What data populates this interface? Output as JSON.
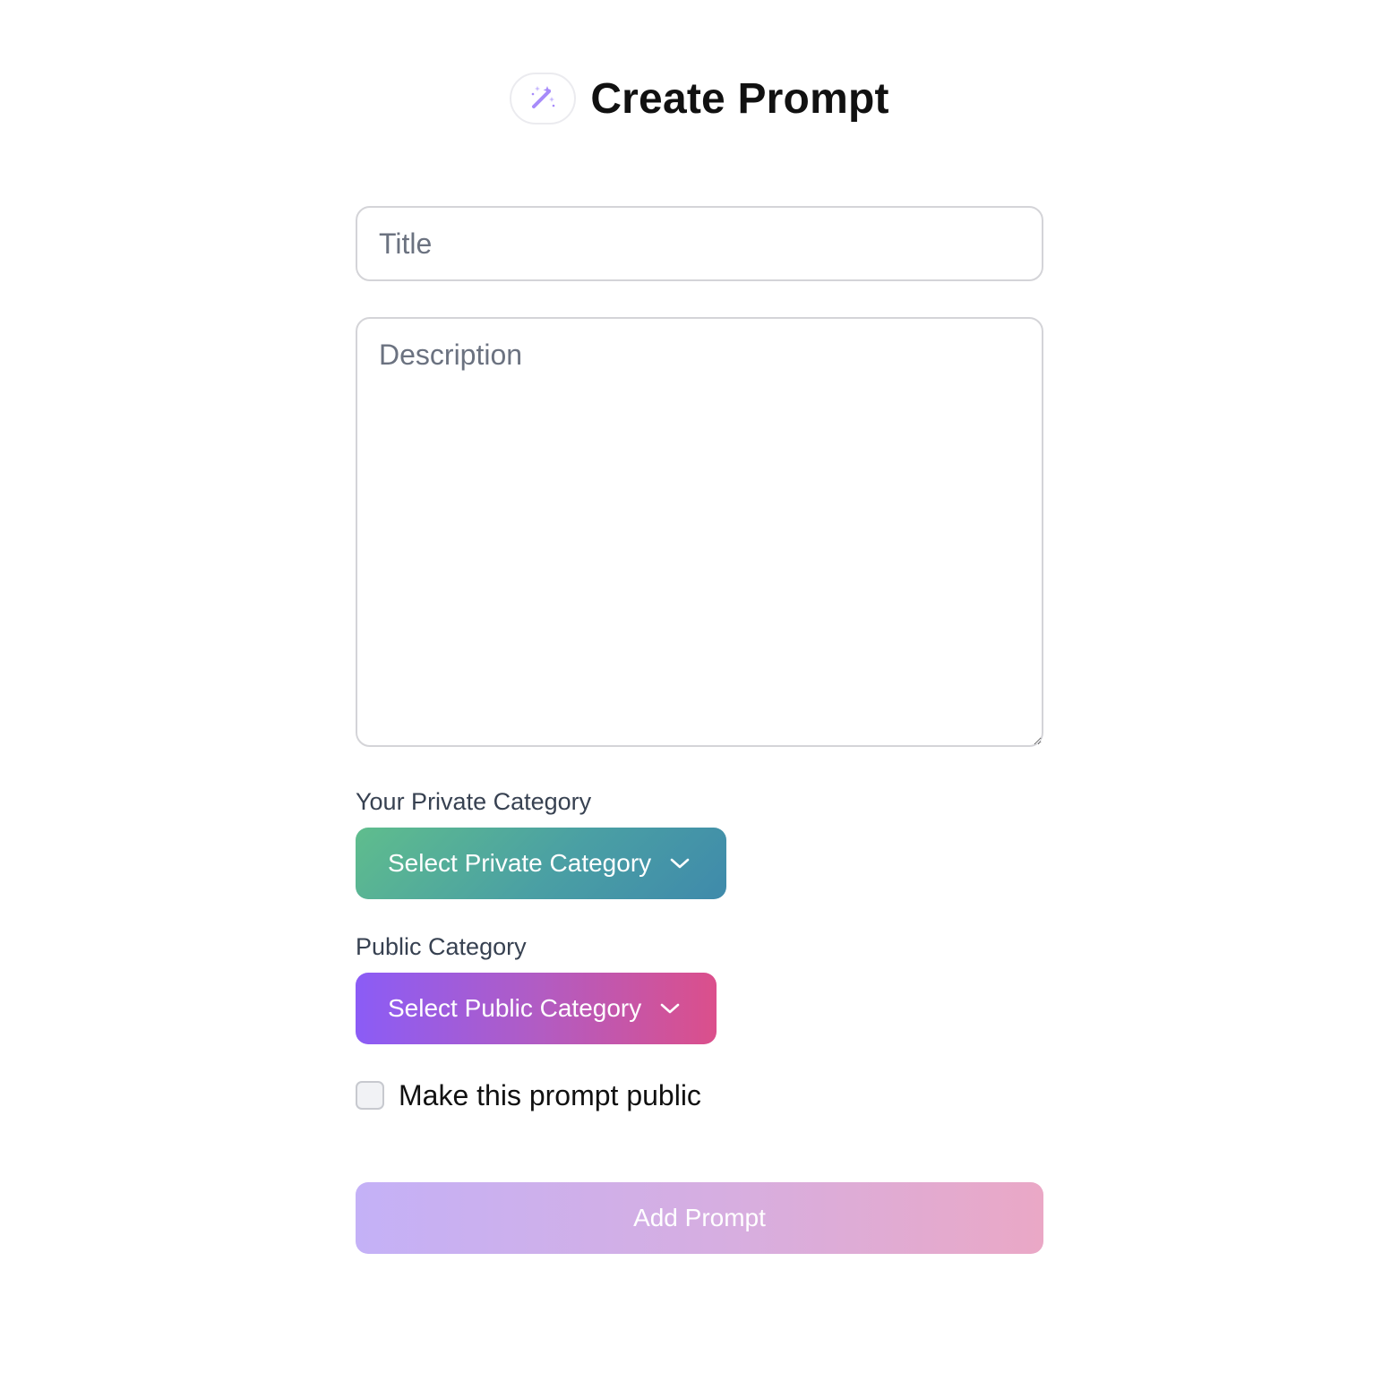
{
  "header": {
    "title": "Create Prompt",
    "icon": "magic-wand-icon",
    "icon_color": "#a78bfa"
  },
  "form": {
    "title_placeholder": "Title",
    "title_value": "",
    "description_placeholder": "Description",
    "description_value": "",
    "private_category": {
      "label": "Your Private Category",
      "selected": "Select Private Category",
      "colors": [
        "#5fbd8d",
        "#3f8aab"
      ]
    },
    "public_category": {
      "label": "Public Category",
      "selected": "Select Public Category",
      "colors": [
        "#8b5cf6",
        "#db4f8b"
      ]
    },
    "make_public": {
      "label": "Make this prompt public",
      "checked": false
    },
    "submit_label": "Add Prompt",
    "submit_colors": [
      "#c4b1f7",
      "#eaa8c6"
    ]
  }
}
